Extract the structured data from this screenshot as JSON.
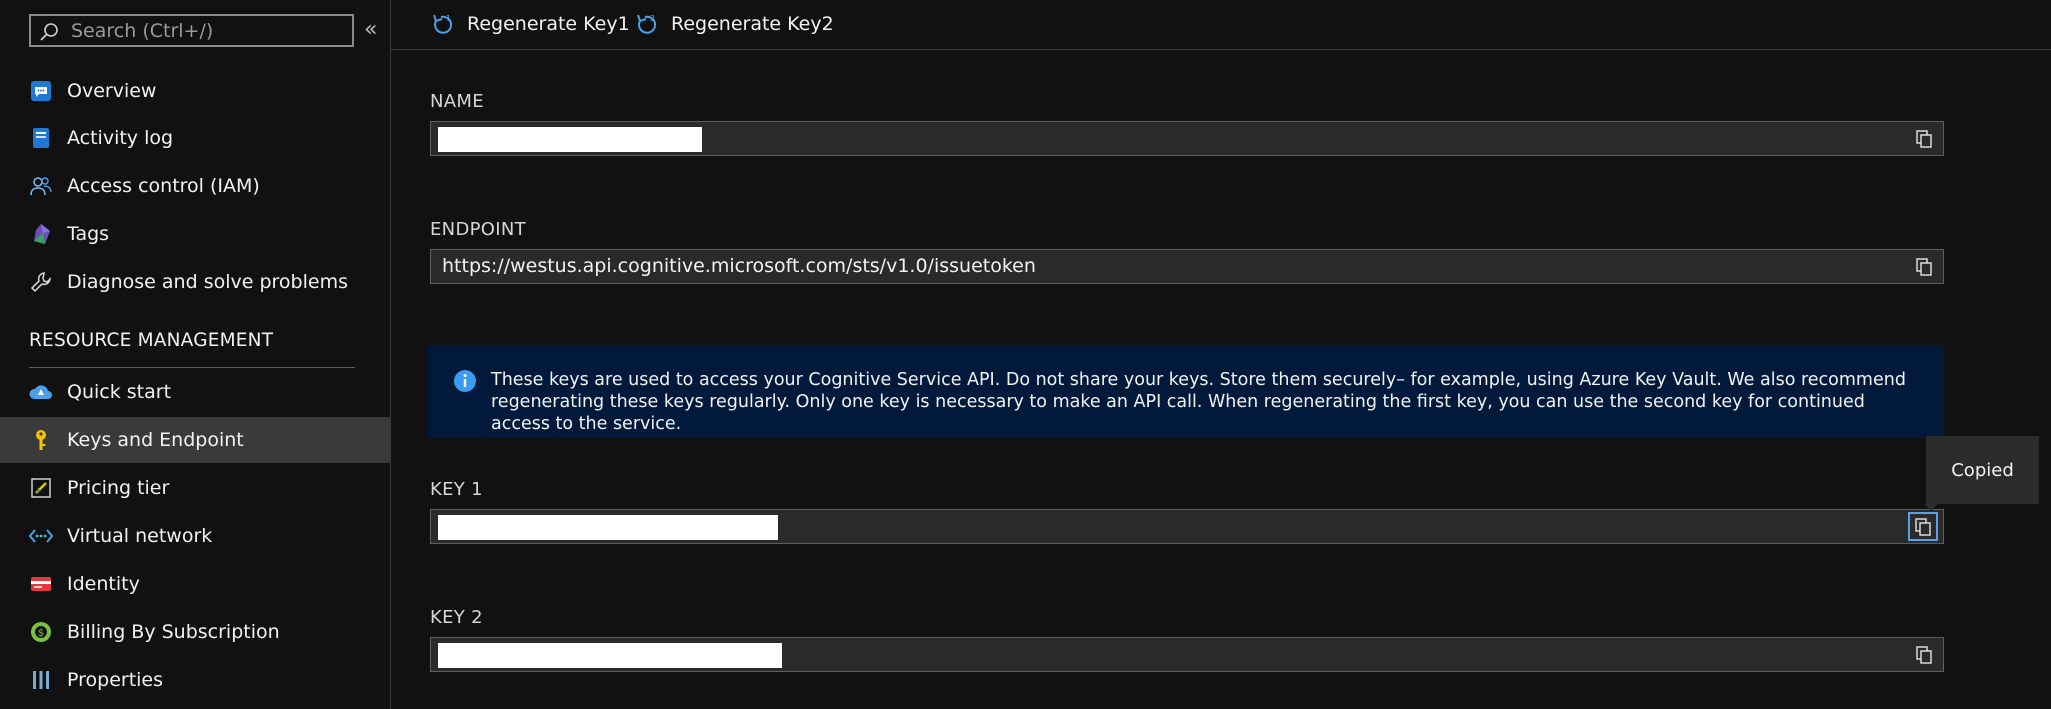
{
  "sidebar": {
    "search": {
      "placeholder": "Search (Ctrl+/)"
    },
    "collapse_label": "«",
    "items_top": [
      {
        "label": "Overview",
        "icon": "overview-icon"
      },
      {
        "label": "Activity log",
        "icon": "activity-log-icon"
      },
      {
        "label": "Access control (IAM)",
        "icon": "iam-icon"
      },
      {
        "label": "Tags",
        "icon": "tag-icon"
      },
      {
        "label": "Diagnose and solve problems",
        "icon": "wrench-icon"
      }
    ],
    "section": "RESOURCE MANAGEMENT",
    "items_resource": [
      {
        "label": "Quick start",
        "icon": "quick-start-icon"
      },
      {
        "label": "Keys and Endpoint",
        "icon": "key-icon",
        "active": true
      },
      {
        "label": "Pricing tier",
        "icon": "pricing-tier-icon"
      },
      {
        "label": "Virtual network",
        "icon": "virtual-network-icon"
      },
      {
        "label": "Identity",
        "icon": "identity-icon"
      },
      {
        "label": "Billing By Subscription",
        "icon": "billing-icon"
      },
      {
        "label": "Properties",
        "icon": "properties-icon"
      }
    ]
  },
  "toolbar": {
    "regen1": "Regenerate Key1",
    "regen2": "Regenerate Key2"
  },
  "fields": {
    "name": {
      "label": "NAME",
      "value": ""
    },
    "endpoint": {
      "label": "ENDPOINT",
      "value": "https://westus.api.cognitive.microsoft.com/sts/v1.0/issuetoken"
    },
    "key1": {
      "label": "KEY 1",
      "value": ""
    },
    "key2": {
      "label": "KEY 2",
      "value": ""
    }
  },
  "info": {
    "text": "These keys are used to access your Cognitive Service API. Do not share your keys. Store them securely– for example, using Azure Key Vault. We also recommend regenerating these keys regularly. Only one key is necessary to make an API call. When regenerating the first key, you can use the second key for continued access to the service."
  },
  "tooltip": "Copied",
  "colors": {
    "background": "#111111",
    "active_item": "#3a3a3a",
    "info_bg": "#011a3c",
    "accent": "#5aa0e6"
  }
}
